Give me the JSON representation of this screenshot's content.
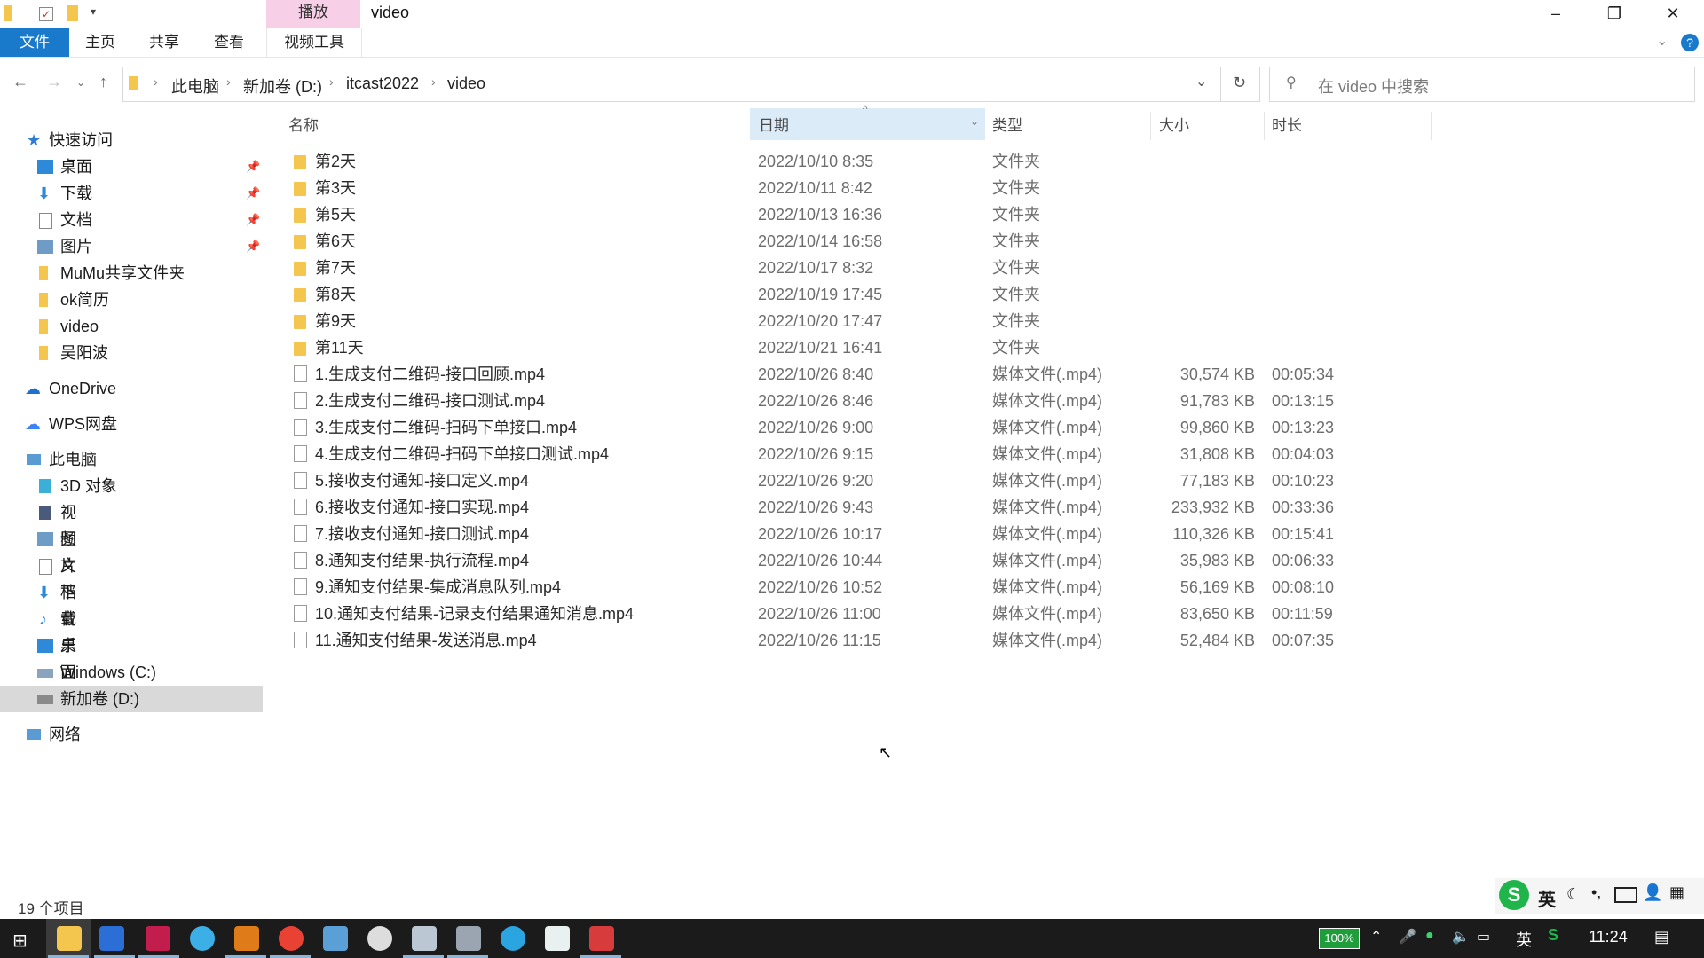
{
  "window": {
    "title": "video",
    "context_tab": "播放",
    "controls": {
      "minimize": "–",
      "maximize": "❐",
      "close": "✕"
    }
  },
  "ribbon": {
    "tabs": [
      "文件",
      "主页",
      "共享",
      "查看",
      "视频工具"
    ],
    "help": "?"
  },
  "address": {
    "crumbs": [
      "此电脑",
      "新加卷 (D:)",
      "itcast2022",
      "video"
    ],
    "search_placeholder": "在 video 中搜索"
  },
  "sidebar": {
    "quick_access": "快速访问",
    "quick_items": [
      {
        "label": "桌面",
        "pinned": true
      },
      {
        "label": "下载",
        "pinned": true
      },
      {
        "label": "文档",
        "pinned": true
      },
      {
        "label": "图片",
        "pinned": true
      },
      {
        "label": "MuMu共享文件夹",
        "pinned": false
      },
      {
        "label": "ok简历",
        "pinned": false
      },
      {
        "label": "video",
        "pinned": false
      },
      {
        "label": "吴阳波",
        "pinned": false
      }
    ],
    "onedrive": "OneDrive",
    "wps": "WPS网盘",
    "this_pc": "此电脑",
    "pc_items": [
      "3D 对象",
      "视频",
      "图片",
      "文档",
      "下载",
      "音乐",
      "桌面",
      "Windows (C:)",
      "新加卷 (D:)"
    ],
    "network": "网络"
  },
  "columns": {
    "name": "名称",
    "date": "日期",
    "type": "类型",
    "size": "大小",
    "duration": "时长"
  },
  "files": [
    {
      "name": "第2天",
      "date": "2022/10/10 8:35",
      "type": "文件夹",
      "size": "",
      "dur": "",
      "folder": true
    },
    {
      "name": "第3天",
      "date": "2022/10/11 8:42",
      "type": "文件夹",
      "size": "",
      "dur": "",
      "folder": true
    },
    {
      "name": "第5天",
      "date": "2022/10/13 16:36",
      "type": "文件夹",
      "size": "",
      "dur": "",
      "folder": true
    },
    {
      "name": "第6天",
      "date": "2022/10/14 16:58",
      "type": "文件夹",
      "size": "",
      "dur": "",
      "folder": true
    },
    {
      "name": "第7天",
      "date": "2022/10/17 8:32",
      "type": "文件夹",
      "size": "",
      "dur": "",
      "folder": true
    },
    {
      "name": "第8天",
      "date": "2022/10/19 17:45",
      "type": "文件夹",
      "size": "",
      "dur": "",
      "folder": true
    },
    {
      "name": "第9天",
      "date": "2022/10/20 17:47",
      "type": "文件夹",
      "size": "",
      "dur": "",
      "folder": true
    },
    {
      "name": "第11天",
      "date": "2022/10/21 16:41",
      "type": "文件夹",
      "size": "",
      "dur": "",
      "folder": true
    },
    {
      "name": "1.生成支付二维码-接口回顾.mp4",
      "date": "2022/10/26 8:40",
      "type": "媒体文件(.mp4)",
      "size": "30,574 KB",
      "dur": "00:05:34",
      "folder": false
    },
    {
      "name": "2.生成支付二维码-接口测试.mp4",
      "date": "2022/10/26 8:46",
      "type": "媒体文件(.mp4)",
      "size": "91,783 KB",
      "dur": "00:13:15",
      "folder": false
    },
    {
      "name": "3.生成支付二维码-扫码下单接口.mp4",
      "date": "2022/10/26 9:00",
      "type": "媒体文件(.mp4)",
      "size": "99,860 KB",
      "dur": "00:13:23",
      "folder": false
    },
    {
      "name": "4.生成支付二维码-扫码下单接口测试.mp4",
      "date": "2022/10/26 9:15",
      "type": "媒体文件(.mp4)",
      "size": "31,808 KB",
      "dur": "00:04:03",
      "folder": false
    },
    {
      "name": "5.接收支付通知-接口定义.mp4",
      "date": "2022/10/26 9:20",
      "type": "媒体文件(.mp4)",
      "size": "77,183 KB",
      "dur": "00:10:23",
      "folder": false
    },
    {
      "name": "6.接收支付通知-接口实现.mp4",
      "date": "2022/10/26 9:43",
      "type": "媒体文件(.mp4)",
      "size": "233,932 KB",
      "dur": "00:33:36",
      "folder": false
    },
    {
      "name": "7.接收支付通知-接口测试.mp4",
      "date": "2022/10/26 10:17",
      "type": "媒体文件(.mp4)",
      "size": "110,326 KB",
      "dur": "00:15:41",
      "folder": false
    },
    {
      "name": "8.通知支付结果-执行流程.mp4",
      "date": "2022/10/26 10:44",
      "type": "媒体文件(.mp4)",
      "size": "35,983 KB",
      "dur": "00:06:33",
      "folder": false
    },
    {
      "name": "9.通知支付结果-集成消息队列.mp4",
      "date": "2022/10/26 10:52",
      "type": "媒体文件(.mp4)",
      "size": "56,169 KB",
      "dur": "00:08:10",
      "folder": false
    },
    {
      "name": "10.通知支付结果-记录支付结果通知消息.mp4",
      "date": "2022/10/26 11:00",
      "type": "媒体文件(.mp4)",
      "size": "83,650 KB",
      "dur": "00:11:59",
      "folder": false
    },
    {
      "name": "11.通知支付结果-发送消息.mp4",
      "date": "2022/10/26 11:15",
      "type": "媒体文件(.mp4)",
      "size": "52,484 KB",
      "dur": "00:07:35",
      "folder": false
    }
  ],
  "status": {
    "count": "19 个项目"
  },
  "ime_bar": {
    "lang": "英"
  },
  "tray": {
    "battery": "100%",
    "lang": "英",
    "time": "11:24"
  },
  "colors": {
    "accent": "#1979ca",
    "selected_bg": "#dcebf8",
    "ribbon_context": "#f7cfe6",
    "taskbar": "#1b1b1b"
  }
}
